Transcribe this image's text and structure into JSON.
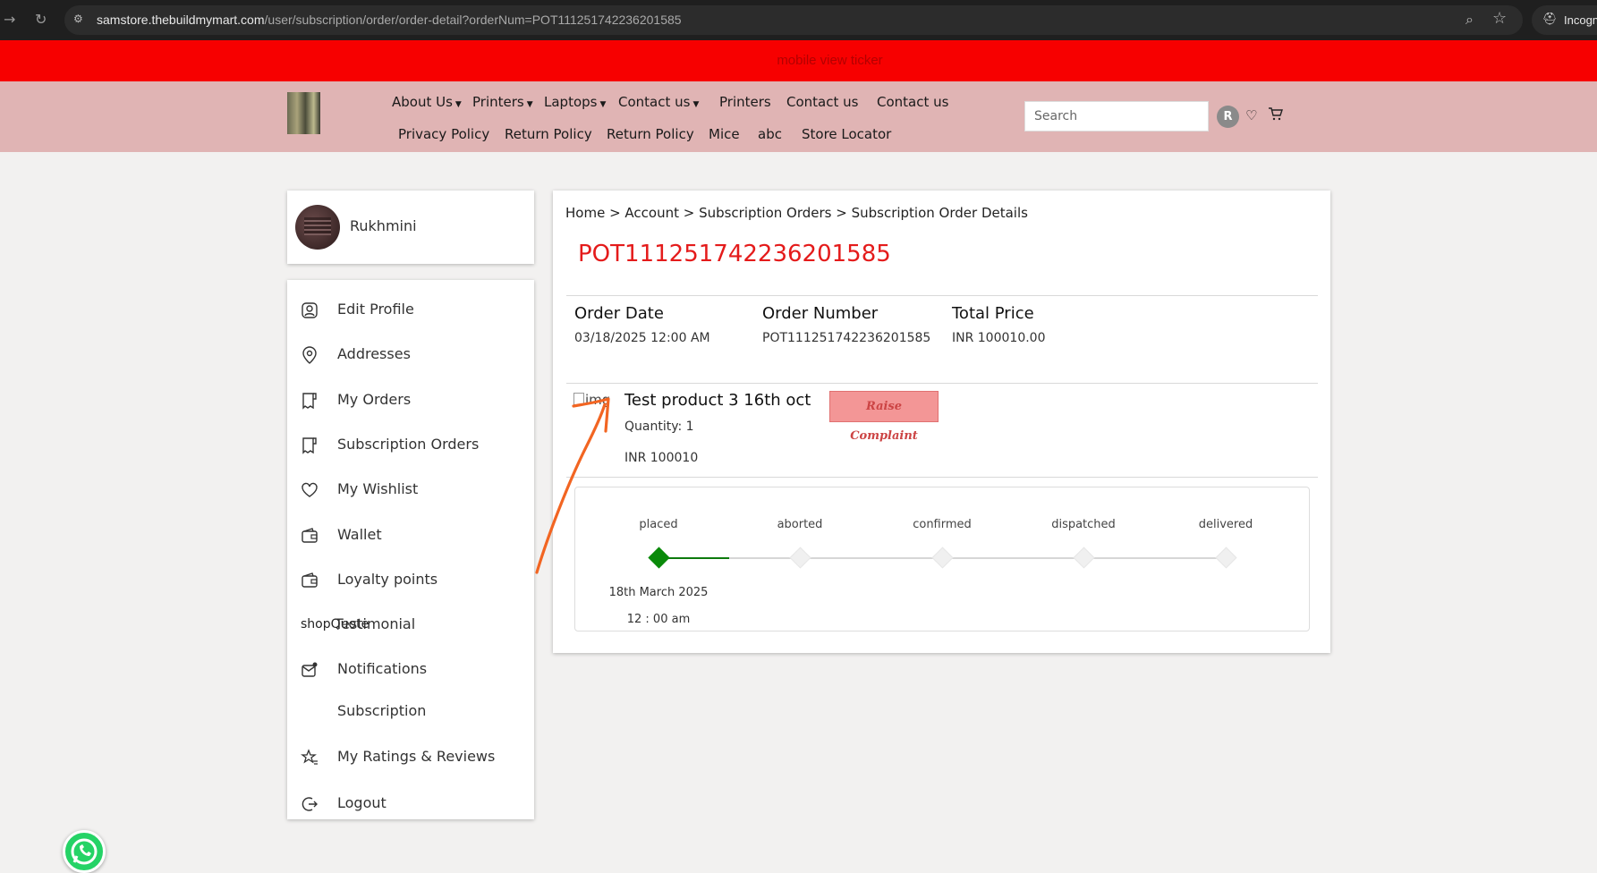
{
  "browser": {
    "url_host": "samstore.thebuildmymart.com",
    "url_path": "/user/subscription/order/order-detail?orderNum=POT111251742236201585",
    "incognito_label": "Incogn"
  },
  "ticker": {
    "text": "mobile view ticker"
  },
  "header": {
    "nav_row1": [
      {
        "label": "About Us",
        "dropdown": true
      },
      {
        "label": "Printers",
        "dropdown": true
      },
      {
        "label": "Laptops",
        "dropdown": true
      },
      {
        "label": "Contact us",
        "dropdown": true
      },
      {
        "label": "Printers",
        "dropdown": false
      },
      {
        "label": "Contact us",
        "dropdown": false
      },
      {
        "label": "Contact us",
        "dropdown": false
      }
    ],
    "nav_row2": [
      {
        "label": "Privacy Policy"
      },
      {
        "label": "Return Policy"
      },
      {
        "label": "Return Policy"
      },
      {
        "label": "Mice"
      },
      {
        "label": "abc"
      },
      {
        "label": "Store Locator"
      }
    ],
    "search_placeholder": "Search",
    "user_initial": "R"
  },
  "profile": {
    "name": "Rukhmini"
  },
  "sidebar": {
    "items": [
      {
        "label": "Edit Profile",
        "icon": "user-icon"
      },
      {
        "label": "Addresses",
        "icon": "location-icon"
      },
      {
        "label": "My Orders",
        "icon": "receipt-icon"
      },
      {
        "label": "Subscription Orders",
        "icon": "receipt-icon"
      },
      {
        "label": "My Wishlist",
        "icon": "heart-icon"
      },
      {
        "label": "Wallet",
        "icon": "wallet-icon"
      },
      {
        "label": "Loyalty points",
        "icon": "wallet-icon"
      },
      {
        "label": "Testimonial",
        "icon": "broken-image",
        "overlay": "shopQuote"
      },
      {
        "label": "Notifications",
        "icon": "mail-icon"
      },
      {
        "label": "Subscription",
        "icon": ""
      },
      {
        "label": "My Ratings & Reviews",
        "icon": "star-icon"
      },
      {
        "label": "Logout",
        "icon": "logout-icon"
      }
    ]
  },
  "breadcrumb": "Home > Account > Subscription Orders > Subscription Order Details",
  "order": {
    "title": "POT111251742236201585",
    "date_label": "Order Date",
    "date_value": "03/18/2025 12:00 AM",
    "number_label": "Order Number",
    "number_value": "POT111251742236201585",
    "price_label": "Total Price",
    "price_value": "INR 100010.00"
  },
  "product": {
    "img_alt": "img",
    "name": "Test product 3 16th oct",
    "quantity": "Quantity: 1",
    "price": "INR 100010",
    "complaint_label": "Raise Complaint"
  },
  "tracker": {
    "stages": [
      "placed",
      "aborted",
      "confirmed",
      "dispatched",
      "delivered"
    ],
    "completed_stages": 1,
    "placed_date": "18th March 2025",
    "placed_time": "12 : 00 am"
  },
  "colors": {
    "ticker_bg": "#f70000",
    "header_bg": "#e0b4b4",
    "order_title": "#e41b1b",
    "tracker_done": "#0a8a0a",
    "annotation_arrow": "#f26522"
  }
}
